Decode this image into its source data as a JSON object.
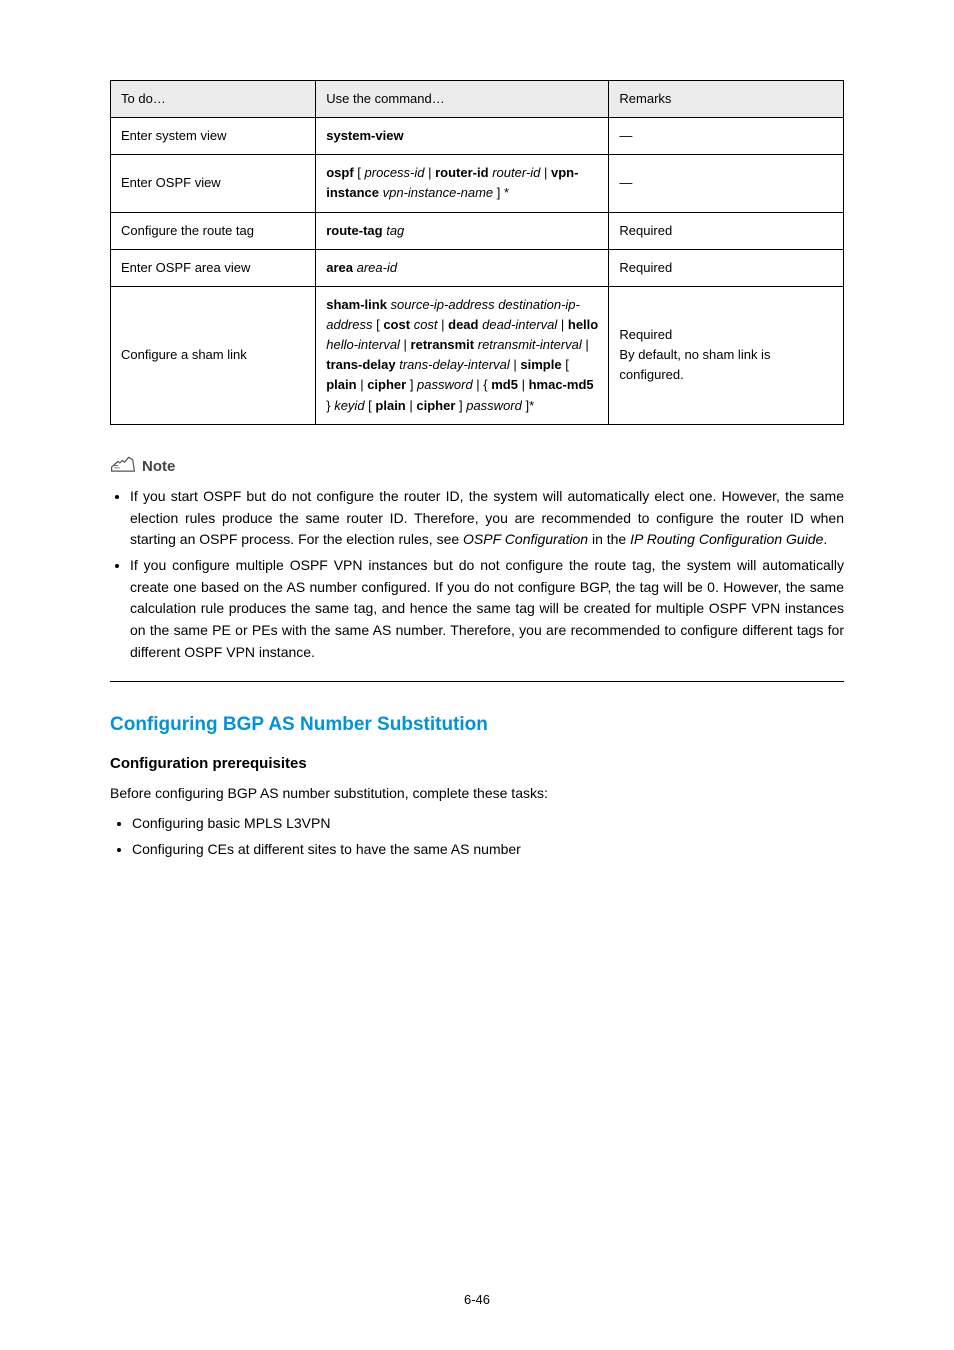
{
  "table": {
    "headers": [
      "To do…",
      "Use the command…",
      "Remarks"
    ],
    "rows": [
      {
        "todo": "Enter system view",
        "cmd_segments": [
          {
            "t": "system-view",
            "s": "bold"
          }
        ],
        "remarks": "—"
      },
      {
        "todo": "Enter OSPF view",
        "cmd_segments": [
          {
            "t": "ospf",
            "s": "bold"
          },
          {
            "t": " [ ",
            "s": ""
          },
          {
            "t": "process-id",
            "s": "ital"
          },
          {
            "t": " | ",
            "s": ""
          },
          {
            "t": "router-id",
            "s": "bold"
          },
          {
            "t": " ",
            "s": ""
          },
          {
            "t": "router-id",
            "s": "ital"
          },
          {
            "t": " | ",
            "s": ""
          },
          {
            "t": "vpn-instance",
            "s": "bold"
          },
          {
            "t": " ",
            "s": ""
          },
          {
            "t": "vpn-instance-name",
            "s": "ital"
          },
          {
            "t": " ] *",
            "s": ""
          }
        ],
        "remarks": "—"
      },
      {
        "todo": "Configure the route tag",
        "cmd_segments": [
          {
            "t": "route-tag",
            "s": "bold"
          },
          {
            "t": " ",
            "s": ""
          },
          {
            "t": "tag",
            "s": "ital"
          }
        ],
        "remarks": "Required"
      },
      {
        "todo": "Enter OSPF area view",
        "cmd_segments": [
          {
            "t": "area",
            "s": "bold"
          },
          {
            "t": " ",
            "s": ""
          },
          {
            "t": "area-id",
            "s": "ital"
          }
        ],
        "remarks": "Required"
      },
      {
        "todo": "Configure a sham link",
        "cmd_segments": [
          {
            "t": "sham-link",
            "s": "bold"
          },
          {
            "t": " ",
            "s": ""
          },
          {
            "t": "source-ip-address destination-ip-address",
            "s": "ital"
          },
          {
            "t": " [ ",
            "s": ""
          },
          {
            "t": "cost",
            "s": "bold"
          },
          {
            "t": " ",
            "s": ""
          },
          {
            "t": "cost",
            "s": "ital"
          },
          {
            "t": " | ",
            "s": ""
          },
          {
            "t": "dead",
            "s": "bold"
          },
          {
            "t": " ",
            "s": ""
          },
          {
            "t": "dead-interval",
            "s": "ital"
          },
          {
            "t": " | ",
            "s": ""
          },
          {
            "t": "hello",
            "s": "bold"
          },
          {
            "t": " ",
            "s": ""
          },
          {
            "t": "hello-interval",
            "s": "ital"
          },
          {
            "t": " | ",
            "s": ""
          },
          {
            "t": "retransmit",
            "s": "bold"
          },
          {
            "t": " ",
            "s": ""
          },
          {
            "t": "retransmit-interval",
            "s": "ital"
          },
          {
            "t": " | ",
            "s": ""
          },
          {
            "t": "trans-delay",
            "s": "bold"
          },
          {
            "t": " ",
            "s": ""
          },
          {
            "t": "trans-delay-interval",
            "s": "ital"
          },
          {
            "t": " | ",
            "s": ""
          },
          {
            "t": "simple",
            "s": "bold"
          },
          {
            "t": " [ ",
            "s": ""
          },
          {
            "t": "plain",
            "s": "bold"
          },
          {
            "t": " | ",
            "s": ""
          },
          {
            "t": "cipher",
            "s": "bold"
          },
          {
            "t": " ] ",
            "s": ""
          },
          {
            "t": "password",
            "s": "ital"
          },
          {
            "t": " | { ",
            "s": ""
          },
          {
            "t": "md5",
            "s": "bold"
          },
          {
            "t": " | ",
            "s": ""
          },
          {
            "t": "hmac-md5",
            "s": "bold"
          },
          {
            "t": " } ",
            "s": ""
          },
          {
            "t": "keyid",
            "s": "ital"
          },
          {
            "t": " [ ",
            "s": ""
          },
          {
            "t": "plain",
            "s": "bold"
          },
          {
            "t": " | ",
            "s": ""
          },
          {
            "t": "cipher",
            "s": "bold"
          },
          {
            "t": " ] ",
            "s": ""
          },
          {
            "t": "password",
            "s": "ital"
          },
          {
            "t": " ]*",
            "s": ""
          }
        ],
        "remarks_lines": [
          "Required",
          "By default, no sham link is configured."
        ]
      }
    ]
  },
  "note_label": "Note",
  "note_items": [
    {
      "pre": "If you start OSPF but do not configure the router ID, the system will automatically elect one. However, the same election rules produce the same router ID. Therefore, you are recommended to configure the router ID when starting an OSPF process. For the election rules, see ",
      "ital1": "OSPF Configuration",
      "mid": " in the ",
      "ital2": "IP Routing Configuration Guide",
      "post": "."
    },
    {
      "pre": "If you configure multiple OSPF VPN instances but do not configure the route tag, the system will automatically create one based on the AS number configured. If you do not configure BGP, the tag will be 0. However, the same calculation rule produces the same tag, and hence the same tag will be created for multiple OSPF VPN instances on the same PE or PEs with the same AS number. Therefore, you are recommended to configure different tags for different OSPF VPN instance."
    }
  ],
  "section_title": "Configuring BGP AS Number Substitution",
  "sub_title": "Configuration prerequisites",
  "sub_para": "Before configuring BGP AS number substitution, complete these tasks:",
  "sub_items": [
    "Configuring basic MPLS L3VPN",
    "Configuring CEs at different sites to have the same AS number"
  ],
  "page_number": "6-46"
}
